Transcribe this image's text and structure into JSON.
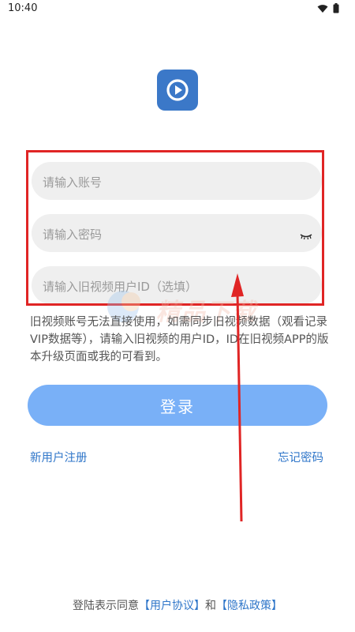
{
  "status_bar": {
    "time": "10:40",
    "icons": [
      "wifi-icon",
      "battery-icon"
    ]
  },
  "logo": {
    "icon": "play-icon",
    "color": "#3b78c8"
  },
  "form": {
    "account_placeholder": "请输入账号",
    "password_placeholder": "请输入密码",
    "old_id_placeholder": "请输入旧视频用户ID（选填）",
    "password_visibility_icon": "eye-closed-icon"
  },
  "watermark": {
    "text": "精品下载"
  },
  "hint": "旧视频账号无法直接使用，如需同步旧视频数据（观看记录 VIP数据等），请输入旧视频的用户ID，ID在旧视频APP的版本升级页面或我的可看到。",
  "login_button": {
    "label": "登录",
    "color": "#79b0f7"
  },
  "links": {
    "register": "新用户注册",
    "forgot_password": "忘记密码"
  },
  "agreement": {
    "prefix": "登陆表示同意",
    "user_agreement": "【用户协议】",
    "conjunction": "和",
    "privacy_policy": "【隐私政策】"
  },
  "annotations": {
    "highlight_color": "#e02525",
    "arrow_color": "#e02525"
  }
}
